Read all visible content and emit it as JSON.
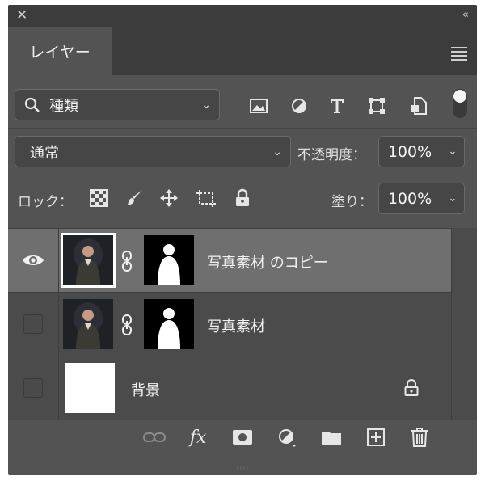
{
  "panel": {
    "tab_label": "レイヤー",
    "close_icon": "close-icon",
    "collapse_icon": "double-chevron-left-icon",
    "menu_icon": "panel-menu-icon"
  },
  "filter": {
    "kind_label": "種類",
    "icons": [
      "pixel-filter-icon",
      "adjustment-filter-icon",
      "type-filter-icon",
      "shape-filter-icon",
      "smart-object-filter-icon"
    ],
    "toggle": "filter-toggle"
  },
  "blend": {
    "mode": "通常",
    "opacity_label": "不透明度：",
    "opacity_value": "100%"
  },
  "lock": {
    "label": "ロック：",
    "icons": [
      "lock-transparent-icon",
      "lock-image-icon",
      "lock-position-icon",
      "lock-artboard-icon",
      "lock-all-icon"
    ],
    "fill_label": "塗り：",
    "fill_value": "100%"
  },
  "layers": [
    {
      "name": "写真素材 のコピー",
      "visible": true,
      "selected": true,
      "has_mask": true
    },
    {
      "name": "写真素材",
      "visible": false,
      "selected": false,
      "has_mask": true
    },
    {
      "name": "背景",
      "visible": false,
      "selected": false,
      "has_mask": false,
      "locked": true
    }
  ],
  "bottom_icons": [
    "link-layers-icon",
    "fx-icon",
    "add-mask-icon",
    "adjustment-layer-icon",
    "group-folder-icon",
    "new-layer-icon",
    "trash-icon"
  ],
  "colors": {
    "panel": "#535353",
    "selected_row": "#6f6f6f",
    "header": "#3c3c3c"
  }
}
